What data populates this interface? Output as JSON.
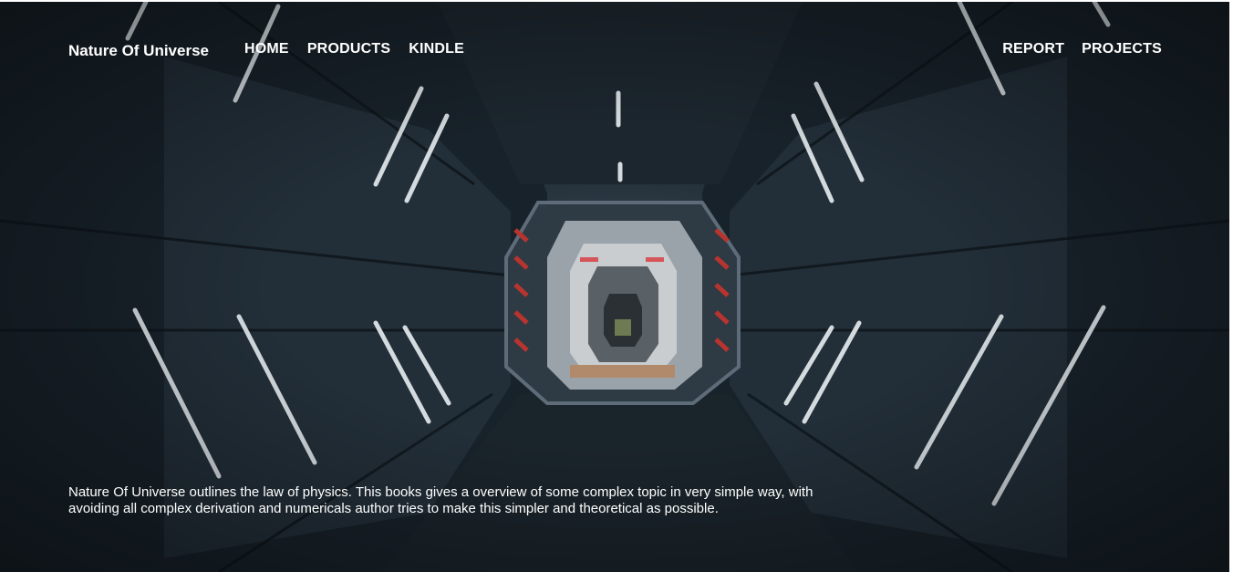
{
  "header": {
    "brand": "Nature Of Universe",
    "nav_left": [
      "HOME",
      "PRODUCTS",
      "KINDLE"
    ],
    "nav_right": [
      "REPORT",
      "PROJECTS"
    ]
  },
  "hero": {
    "background": "sci-fi space station corridor",
    "description": "Nature Of Universe outlines the law of physics. This books gives a overview of some complex topic in very simple way, with avoiding all complex derivation and numericals author tries to make this simpler and theoretical as possible."
  },
  "colors": {
    "text": "#ffffff",
    "background_dark": "#141c22",
    "hazard_red": "#b8342e"
  }
}
